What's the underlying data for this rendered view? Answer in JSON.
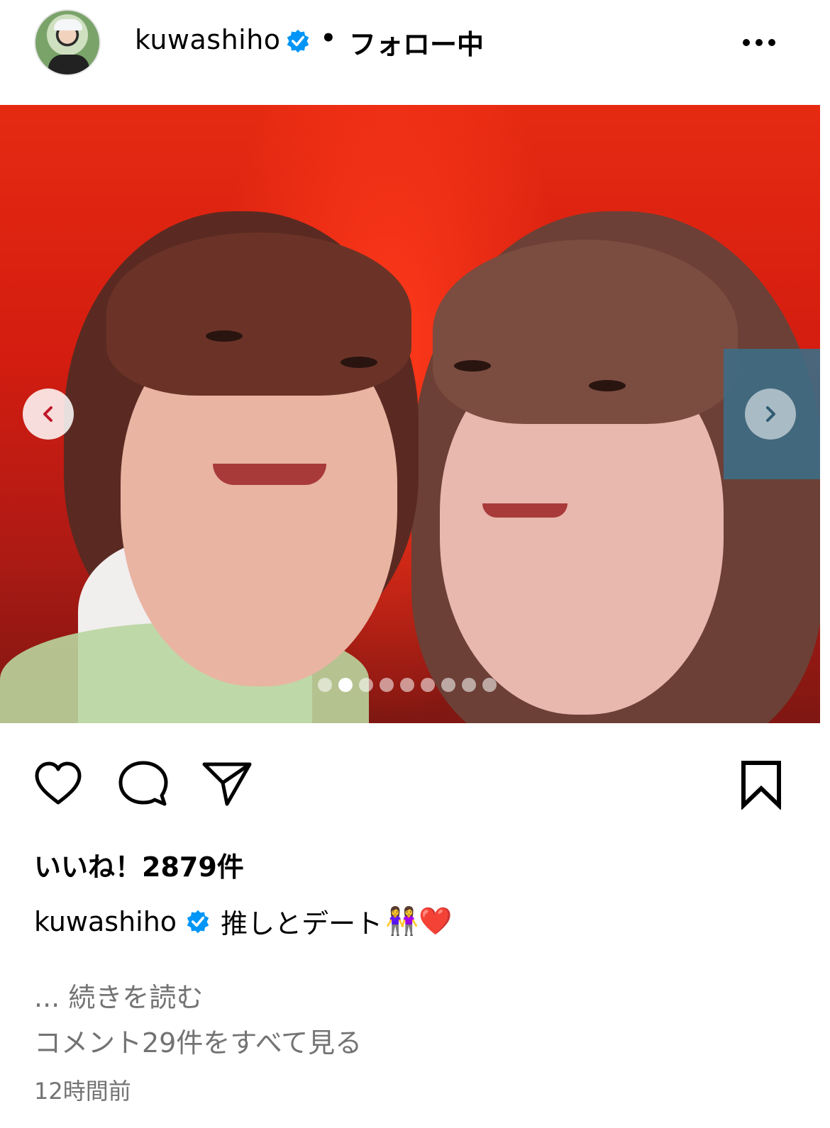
{
  "header": {
    "username": "kuwashiho",
    "separator": "•",
    "follow_status": "フォロー中",
    "more_icon": "more-horizontal-icon",
    "verified_icon": "verified-badge-icon"
  },
  "post": {
    "carousel": {
      "dot_count": 9,
      "active_index": 1,
      "prev_icon": "chevron-left-icon",
      "next_icon": "chevron-right-icon"
    }
  },
  "actions": {
    "like_icon": "heart-icon",
    "comment_icon": "comment-icon",
    "share_icon": "paper-plane-icon",
    "save_icon": "bookmark-icon"
  },
  "likes": "いいね！2879件",
  "caption": {
    "username": "kuwashiho",
    "text": "推しとデート",
    "emojis": "👭❤️"
  },
  "read_more": "... 続きを読む",
  "view_comments": "コメント29件をすべて見る",
  "timestamp": "12時間前",
  "colors": {
    "verified_blue": "#0095f6",
    "secondary_text": "#737373"
  }
}
